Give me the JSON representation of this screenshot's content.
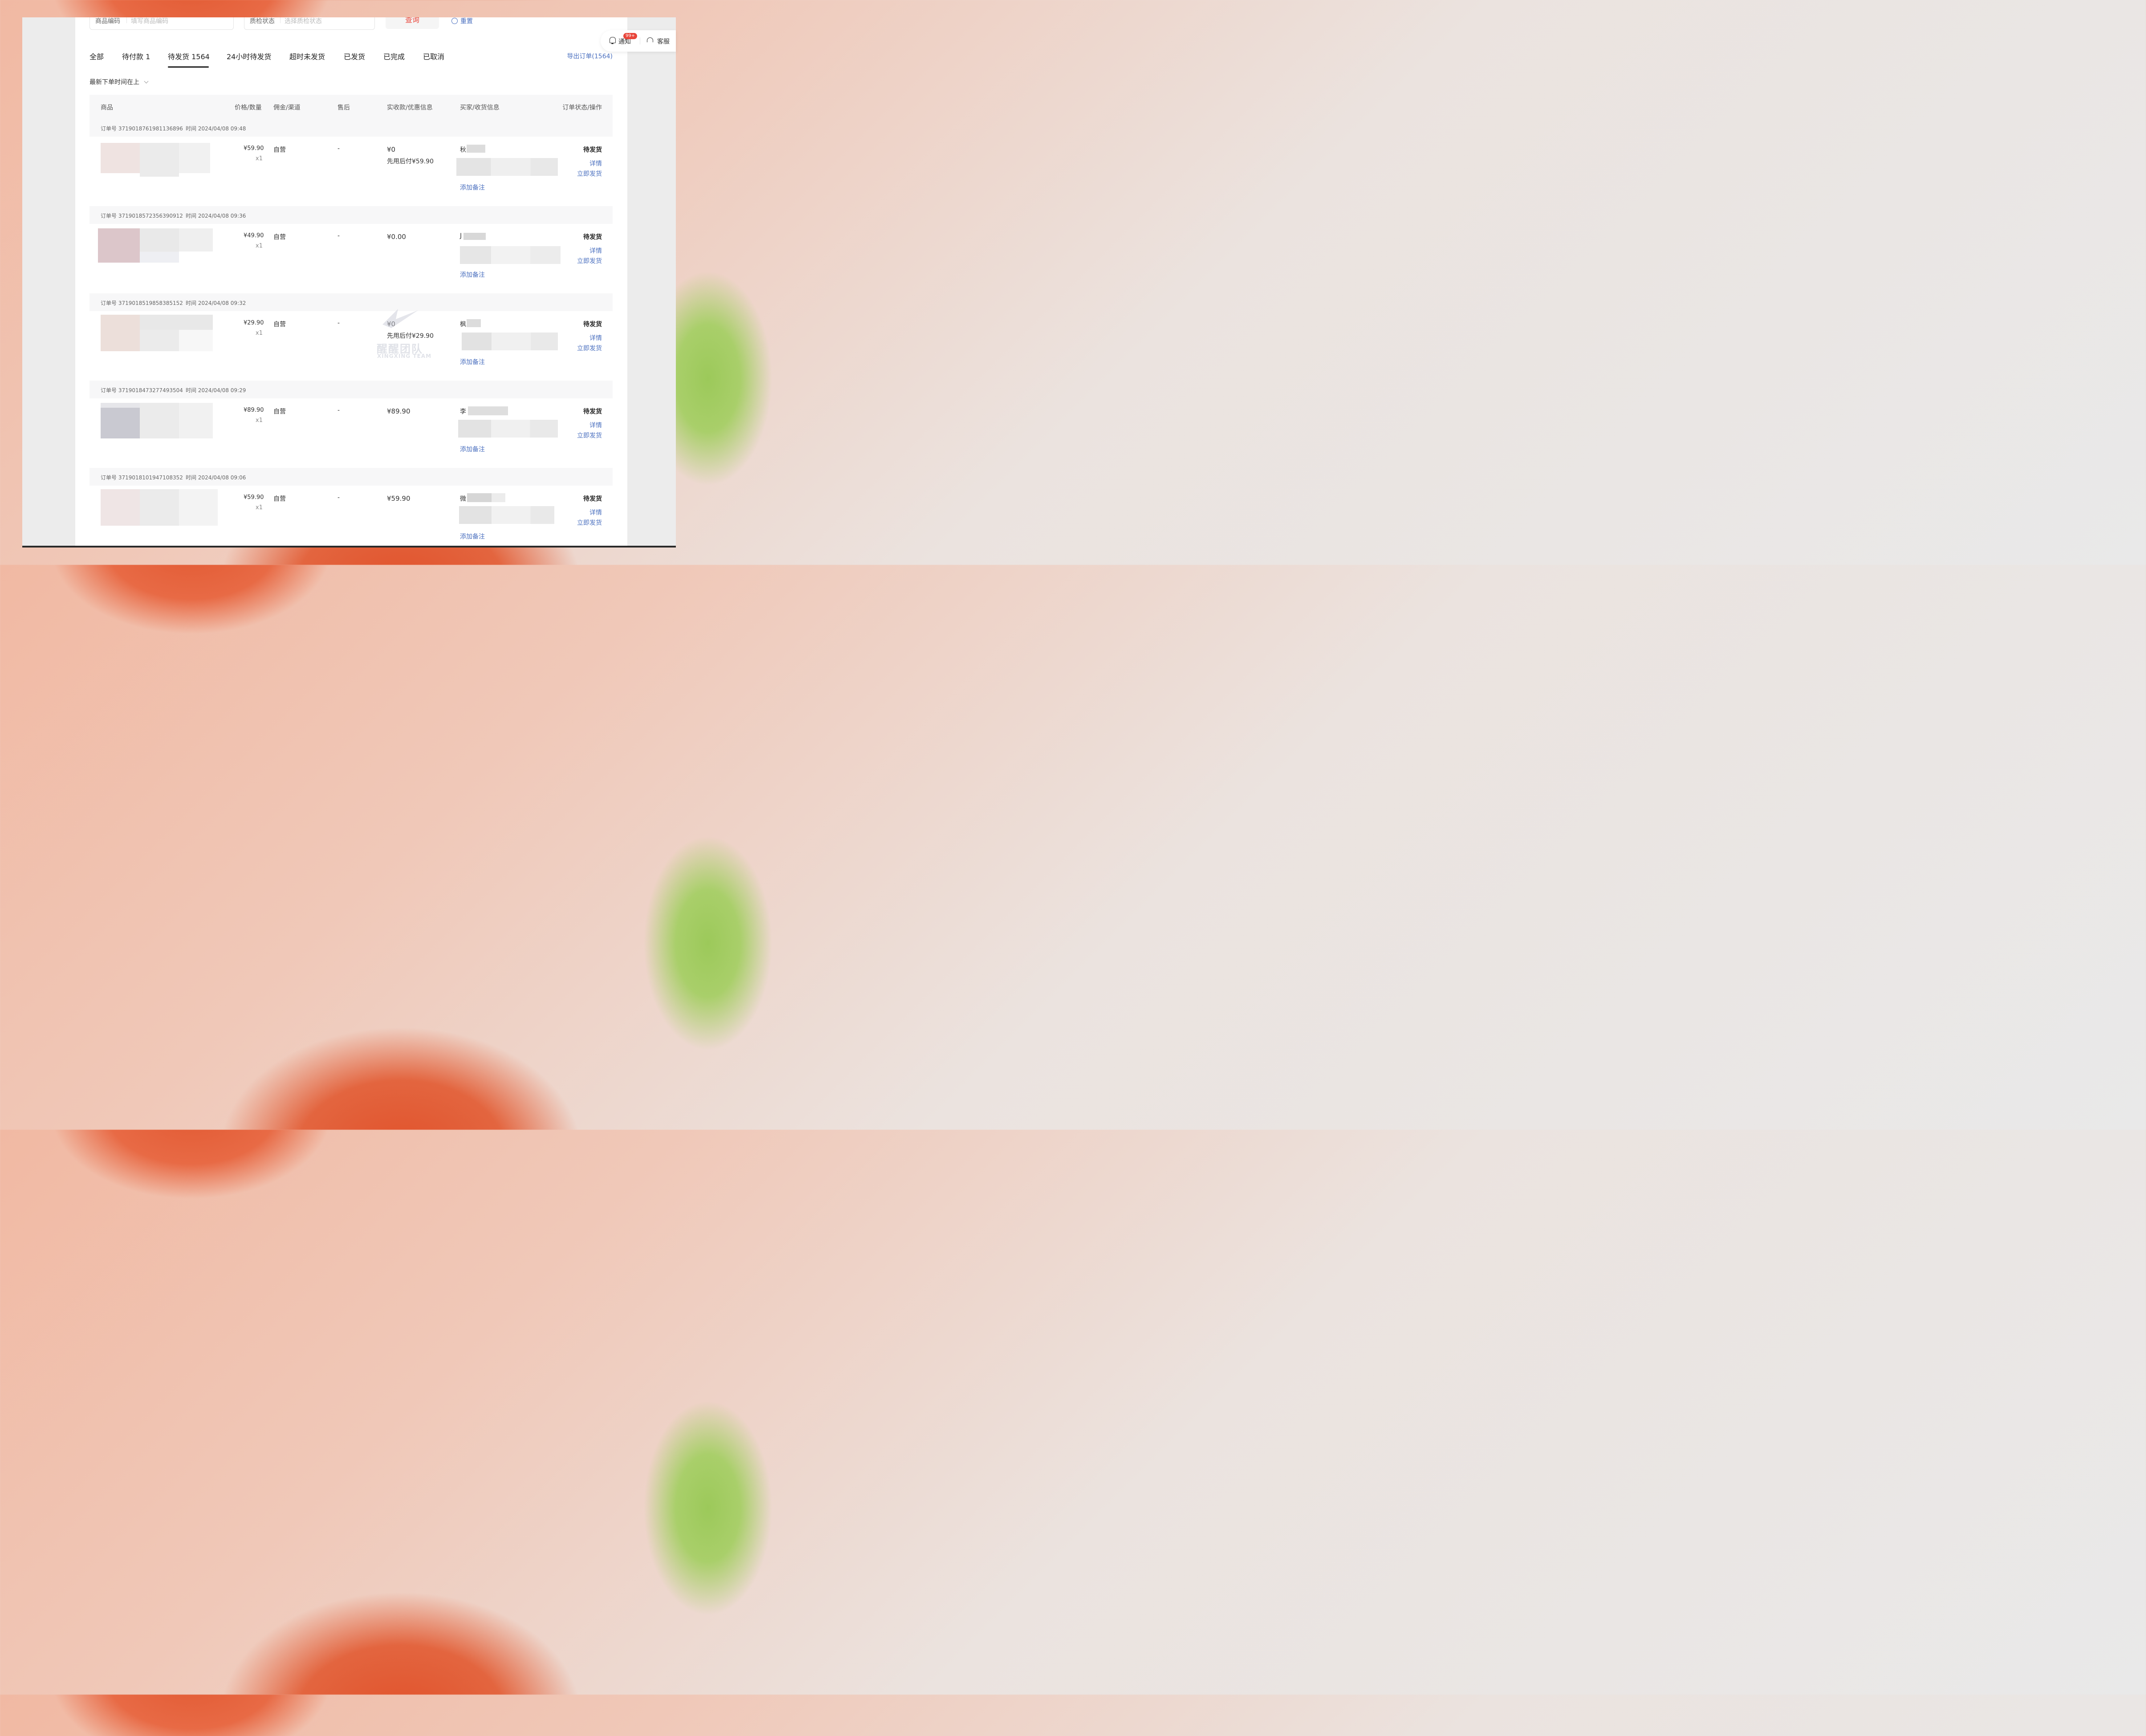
{
  "filters": {
    "product_code_label": "商品编码",
    "product_code_placeholder": "填写商品编码",
    "qc_status_label": "质检状态",
    "qc_status_placeholder": "选择质检状态",
    "query_button": "查询",
    "reset_button": "重置"
  },
  "tabs": [
    {
      "label": "全部"
    },
    {
      "label": "待付款 1"
    },
    {
      "label": "待发货 1564"
    },
    {
      "label": "24小时待发货"
    },
    {
      "label": "超时未发货"
    },
    {
      "label": "已发货"
    },
    {
      "label": "已完成"
    },
    {
      "label": "已取消"
    }
  ],
  "export_link": "导出订单(1564)",
  "sort_label": "最新下单时间在上",
  "float_widget": {
    "notify_label": "通知",
    "notify_badge": "99+",
    "service_label": "客服"
  },
  "table_headers": [
    "商品",
    "价格/数量",
    "佣金/渠道",
    "售后",
    "实收款/优惠信息",
    "买家/收货信息",
    "订单状态/操作"
  ],
  "orders": [
    {
      "order_no": "订单号 3719018761981136896",
      "time": "时间 2024/04/08 09:48",
      "price": "¥59.90",
      "qty": "x1",
      "channel": "自营",
      "after_sale": "-",
      "paid": "¥0",
      "discount": "先用后付¥59.90",
      "buyer": "秋",
      "add_note": "添加备注",
      "status": "待发货",
      "detail": "详情",
      "ship": "立即发货"
    },
    {
      "order_no": "订单号 3719018572356390912",
      "time": "时间 2024/04/08 09:36",
      "price": "¥49.90",
      "qty": "x1",
      "channel": "自营",
      "after_sale": "-",
      "paid": "¥0.00",
      "discount": "",
      "buyer": "J",
      "add_note": "添加备注",
      "status": "待发货",
      "detail": "详情",
      "ship": "立即发货"
    },
    {
      "order_no": "订单号 3719018519858385152",
      "time": "时间 2024/04/08 09:32",
      "price": "¥29.90",
      "qty": "x1",
      "channel": "自营",
      "after_sale": "-",
      "paid": "¥0",
      "discount": "先用后付¥29.90",
      "buyer": "枫",
      "add_note": "添加备注",
      "status": "待发货",
      "detail": "详情",
      "ship": "立即发货"
    },
    {
      "order_no": "订单号 3719018473277493504",
      "time": "时间 2024/04/08 09:29",
      "price": "¥89.90",
      "qty": "x1",
      "channel": "自营",
      "after_sale": "-",
      "paid": "¥89.90",
      "discount": "",
      "buyer": "李",
      "add_note": "添加备注",
      "status": "待发货",
      "detail": "详情",
      "ship": "立即发货"
    },
    {
      "order_no": "订单号 3719018101947108352",
      "time": "时间 2024/04/08 09:06",
      "price": "¥59.90",
      "qty": "x1",
      "channel": "自营",
      "after_sale": "-",
      "paid": "¥59.90",
      "discount": "",
      "buyer": "微",
      "add_note": "添加备注",
      "status": "待发货",
      "detail": "详情",
      "ship": "立即发货"
    }
  ],
  "watermark": {
    "title": "醒醒团队",
    "subtitle": "XINGXING TEAM"
  },
  "colors": {
    "accent_blue": "#4a6fbf",
    "query_red": "#e8453a",
    "badge_red": "#e8453a"
  }
}
